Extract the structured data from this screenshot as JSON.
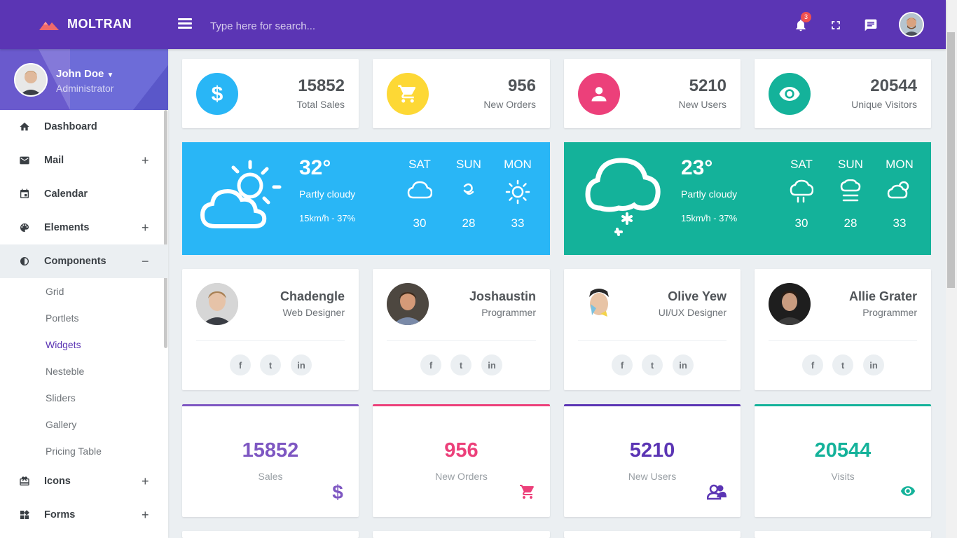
{
  "app": {
    "brand": "MOLTRAN"
  },
  "search": {
    "placeholder": "Type here for search..."
  },
  "notifications": {
    "count": "3"
  },
  "user": {
    "name": "John Doe",
    "role": "Administrator"
  },
  "nav": {
    "items": [
      {
        "label": "Dashboard",
        "icon": "home-icon",
        "sign": ""
      },
      {
        "label": "Mail",
        "icon": "mail-icon",
        "sign": "+"
      },
      {
        "label": "Calendar",
        "icon": "calendar-icon",
        "sign": ""
      },
      {
        "label": "Elements",
        "icon": "palette-icon",
        "sign": "+"
      },
      {
        "label": "Components",
        "icon": "contrast-icon",
        "sign": "−"
      }
    ],
    "subitems": [
      "Grid",
      "Portlets",
      "Widgets",
      "Nesteble",
      "Sliders",
      "Gallery",
      "Pricing Table"
    ],
    "active_subitem": "Widgets",
    "items2": [
      {
        "label": "Icons",
        "icon": "gift-icon",
        "sign": "+"
      },
      {
        "label": "Forms",
        "icon": "widgets-icon",
        "sign": "+"
      }
    ]
  },
  "stats": [
    {
      "value": "15852",
      "label": "Total Sales",
      "color": "#29b6f6",
      "icon": "dollar-icon"
    },
    {
      "value": "956",
      "label": "New Orders",
      "color": "#fdd835",
      "icon": "cart-icon"
    },
    {
      "value": "5210",
      "label": "New Users",
      "color": "#ec407a",
      "icon": "user-icon"
    },
    {
      "value": "20544",
      "label": "Unique Visitors",
      "color": "#14b29a",
      "icon": "eye-icon"
    }
  ],
  "weather": [
    {
      "temp": "32°",
      "condition": "Partly cloudy",
      "wind": "15km/h - 37%",
      "color": "#29b6f6",
      "days": [
        {
          "day": "SAT",
          "value": "30",
          "icon": "cloud-icon"
        },
        {
          "day": "SUN",
          "value": "28",
          "icon": "swirl-icon"
        },
        {
          "day": "MON",
          "value": "33",
          "icon": "sun-icon"
        }
      ]
    },
    {
      "temp": "23°",
      "condition": "Partly cloudy",
      "wind": "15km/h - 37%",
      "color": "#14b29a",
      "days": [
        {
          "day": "SAT",
          "value": "30",
          "icon": "rain-cloud-icon"
        },
        {
          "day": "SUN",
          "value": "28",
          "icon": "fog-icon"
        },
        {
          "day": "MON",
          "value": "33",
          "icon": "cloud-sun-icon"
        }
      ]
    }
  ],
  "profiles": [
    {
      "name": "Chadengle",
      "role": "Web Designer"
    },
    {
      "name": "Joshaustin",
      "role": "Programmer"
    },
    {
      "name": "Olive Yew",
      "role": "UI/UX Designer"
    },
    {
      "name": "Allie Grater",
      "role": "Programmer"
    }
  ],
  "social": {
    "facebook": "f",
    "twitter": "t",
    "linkedin": "in"
  },
  "kpis": [
    {
      "value": "15852",
      "label": "Sales",
      "color": "#7e57c2",
      "icon": "dollar-icon"
    },
    {
      "value": "956",
      "label": "New Orders",
      "color": "#ec407a",
      "icon": "cart-icon"
    },
    {
      "value": "5210",
      "label": "New Users",
      "color": "#5b35b4",
      "icon": "users-icon"
    },
    {
      "value": "20544",
      "label": "Visits",
      "color": "#14b29a",
      "icon": "eye-icon"
    }
  ]
}
